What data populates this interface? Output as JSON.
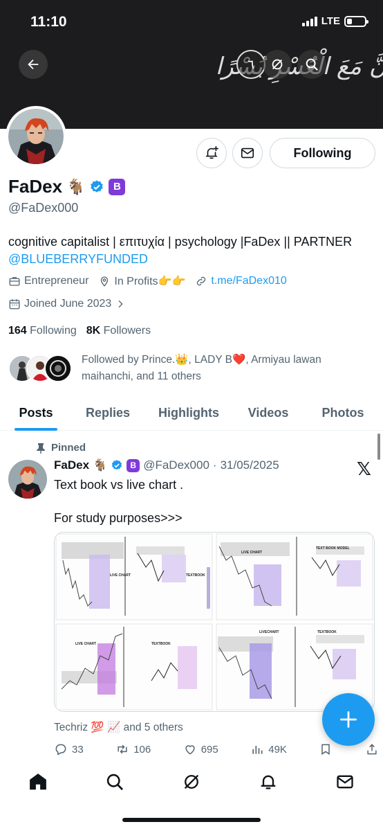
{
  "status_bar": {
    "time": "11:10",
    "network": "LTE",
    "battery_level": 0.3
  },
  "banner": {
    "calligraphy": "إِنَّ مَعَ الْعُسْرِ يُسْرًا",
    "badge_number": "٦",
    "colors": {
      "background": "#1c1c1e"
    }
  },
  "profile": {
    "name": "FaDex",
    "name_emoji": "🐐",
    "badge_letter": "B",
    "handle": "@FaDex000",
    "follow_button": "Following",
    "bio_text": "cognitive capitalist | επιτυχία | psychology |FaDex || PARTNER",
    "bio_link": "@BLUEBERRYFUNDED",
    "meta": {
      "profession": "Entrepreneur",
      "location": "In Profits👉👉",
      "website": "t.me/FaDex010",
      "joined": "Joined June 2023"
    },
    "following_count": "164",
    "following_label": "Following",
    "followers_count": "8K",
    "followers_label": "Followers",
    "followed_by": "Followed by Prince.👑, LADY B❤️, Armiyau lawan maihanchi, and 11 others"
  },
  "tabs": [
    {
      "label": "Posts",
      "active": true
    },
    {
      "label": "Replies",
      "active": false
    },
    {
      "label": "Highlights",
      "active": false
    },
    {
      "label": "Videos",
      "active": false
    },
    {
      "label": "Photos",
      "active": false
    }
  ],
  "post": {
    "pinned_label": "Pinned",
    "author_name": "FaDex",
    "author_emoji": "🐐",
    "badge_letter": "B",
    "handle": "@FaDex000",
    "separator": "·",
    "date": "31/05/2025",
    "text": "Text book vs live chart .\n\nFor study purposes>>>",
    "media_labels": {
      "live_chart": "LIVE CHART",
      "textbook": "TEXTBOOK",
      "text_book_model": "TEXT BOOK MODEL",
      "livechart": "LIVECHART"
    },
    "liked_by": "Techriz 💯 📈 and 5 others",
    "stats": {
      "replies": "33",
      "reposts": "106",
      "likes": "695",
      "views": "49K"
    }
  },
  "colors": {
    "accent": "#1d9bf0",
    "secondary_text": "#536471",
    "badge_purple": "#7e3bd8",
    "chart_zone": "#b8a6e6"
  }
}
